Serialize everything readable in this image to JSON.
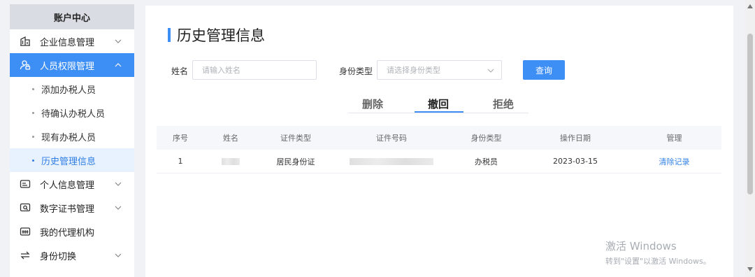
{
  "sidebar": {
    "title": "账户中心",
    "items": [
      {
        "label": "企业信息管理",
        "icon": "building-icon"
      },
      {
        "label": "人员权限管理",
        "icon": "person-lock-icon",
        "active": true
      },
      {
        "label": "个人信息管理",
        "icon": "id-card-icon"
      },
      {
        "label": "数字证书管理",
        "icon": "certificate-icon"
      },
      {
        "label": "我的代理机构",
        "icon": "agency-icon"
      },
      {
        "label": "身份切换",
        "icon": "switch-icon"
      }
    ],
    "subitems": [
      "添加办税人员",
      "待确认办税人员",
      "现有办税人员",
      "历史管理信息"
    ]
  },
  "main": {
    "title": "历史管理信息",
    "search": {
      "name_label": "姓名",
      "name_placeholder": "请输入姓名",
      "role_label": "身份类型",
      "role_placeholder": "请选择身份类型",
      "query_button": "查询"
    },
    "tabs": [
      "删除",
      "撤回",
      "拒绝"
    ],
    "active_tab": "撤回",
    "table": {
      "headers": [
        "序号",
        "姓名",
        "证件类型",
        "证件号码",
        "身份类型",
        "操作日期",
        "管理"
      ],
      "rows": [
        {
          "index": "1",
          "id_type": "居民身份证",
          "role": "办税员",
          "date": "2023-03-15",
          "action": "清除记录"
        }
      ]
    }
  },
  "watermark": {
    "line1": "激活 Windows",
    "line2": "转到\"设置\"以激活 Windows。"
  },
  "colors": {
    "accent": "#3d8ef5",
    "link": "#2f7fe6",
    "sidebar_header": "#d9dde3",
    "selected_bg": "#e8f2fe"
  }
}
